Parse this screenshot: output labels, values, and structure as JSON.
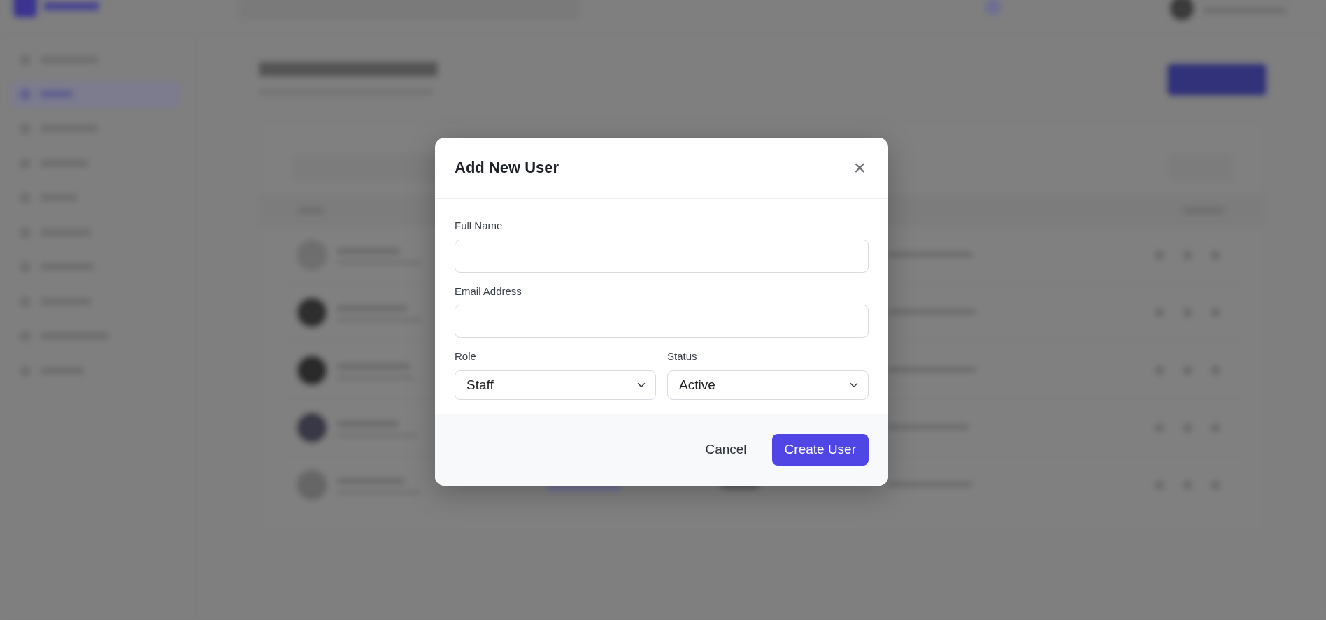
{
  "modal": {
    "title": "Add New User",
    "close": "×",
    "fields": [
      {
        "kind": "text",
        "label": "Full Name"
      },
      {
        "kind": "text",
        "label": "Email Address"
      },
      {
        "kind": "select",
        "label": "Role",
        "value": "Staff"
      },
      {
        "kind": "select",
        "label": "Status",
        "value": "Active"
      }
    ],
    "buttons": [
      {
        "kind": "secondary",
        "label": "Cancel"
      },
      {
        "kind": "primary",
        "label": "Create User"
      }
    ]
  }
}
